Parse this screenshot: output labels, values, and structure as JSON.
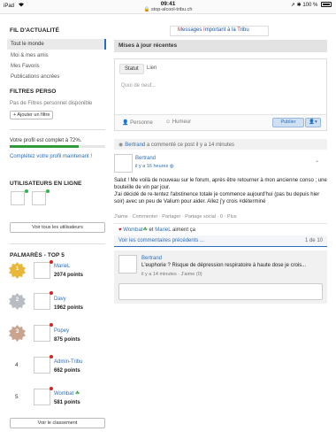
{
  "status_bar": {
    "device": "iPad",
    "wifi": "wifi-icon",
    "time": "09:41",
    "url": "stop-alcool-tribu.ch",
    "battery": "100 %"
  },
  "banner": {
    "words": [
      "M",
      "essages ",
      "I",
      "mportant à la ",
      "T",
      "ribu"
    ]
  },
  "left": {
    "feed_title": "FIL D'ACTUALITÉ",
    "feed_items": [
      {
        "label": "Tout le monde",
        "active": true
      },
      {
        "label": "Moi & mes amis",
        "active": false
      },
      {
        "label": "Mes Favoris",
        "active": false
      },
      {
        "label": "Publications ancrées",
        "active": false
      }
    ],
    "filters_title": "FILTRES PERSO",
    "filters_empty": "Pas de Filtres personnel disponible",
    "add_filter": "+ Ajouter un filtre",
    "profile_complete": "Votre profil est complet à 72%.",
    "profile_progress": 0.72,
    "complete_profile_link": "Complétez votre profil maintenant !",
    "online_title": "UTILISATEURS EN LIGNE",
    "see_all_users": "Voir tous les utilisateurs",
    "palmares_title": "PALMARÈS - TOP 5",
    "ranking": [
      {
        "rank": "1",
        "name": "MarieL",
        "points": "2074 points",
        "medal": "gold"
      },
      {
        "rank": "2",
        "name": "Davy",
        "points": "1962 points",
        "medal": "silver"
      },
      {
        "rank": "3",
        "name": "Popey",
        "points": "875 points",
        "medal": "bronze"
      },
      {
        "rank": "4",
        "name": "Admin-Tribu",
        "points": "662 points",
        "medal": ""
      },
      {
        "rank": "5",
        "name": "Wombat",
        "points": "581 points",
        "medal": ""
      }
    ],
    "see_ranking": "Voir le classement"
  },
  "main": {
    "section_title": "Mises à jour récentes",
    "composer": {
      "tab_status": "Statut",
      "tab_link": "Lien",
      "placeholder": "Quoi de neuf...",
      "person": "Personne",
      "mood": "Humeur",
      "publish": "Publier",
      "privacy_icon": "person-icon"
    },
    "post": {
      "meta_author": "Bertrand",
      "meta_text": " a commenté ce post il y a 14 minutes",
      "author": "Bertrand",
      "time": "il y a 16 heures",
      "body_1": "Salut ! Me voilà de nouveau sur le forum, après être retourner à mon ancienne conso ; une bouteille de vin par jour.",
      "body_2": "J'ai décidé de re-tentez l'abstinence totale je commence aujourd'hui (pas bu depuis hier soir) avec un peu de Valium pour aider. Allez j'y crois #déterminé",
      "actions": "J'aime · Commenter · Partager · Partage social · 0 · Plus",
      "likes_user1": "Wombat",
      "likes_and": " et ",
      "likes_user2": "MarieL",
      "likes_suffix": " aiment ça",
      "prev_comments": "Voir les commentaires précédents ...",
      "comment_count": "1 de 10",
      "comment": {
        "author": "Bertrand",
        "text": "L'euphorie ? Risque de dépression respiratoire à haute dose je crois...",
        "meta": "il y a 14 minutes · J'aime (0)"
      }
    }
  }
}
